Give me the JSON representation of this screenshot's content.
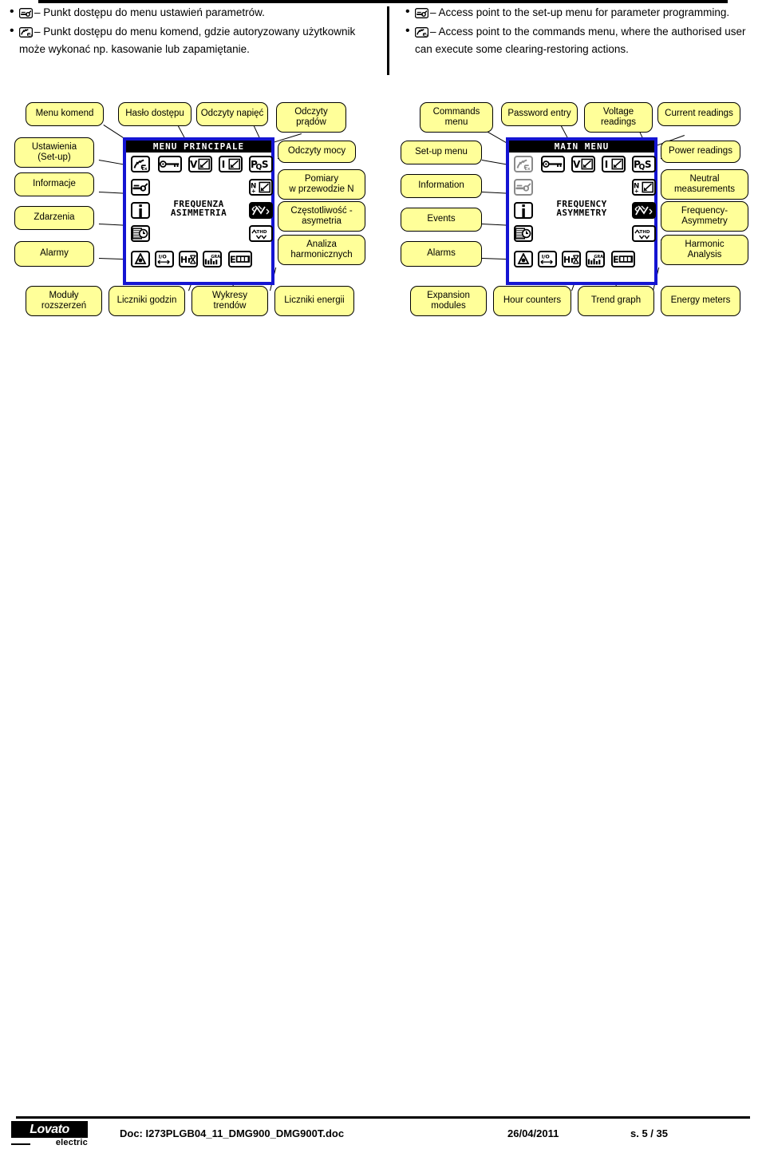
{
  "intro": {
    "left_bullets": [
      {
        "icon": "wrench-setup-icon",
        "text": "– Punkt dostępu do menu ustawień parametrów."
      },
      {
        "icon": "commands-hand-icon",
        "text": "– Punkt dostępu do menu komend, gdzie autoryzowany użytkownik może wykonać np. kasowanie lub zapamiętanie."
      }
    ],
    "right_bullets": [
      {
        "icon": "wrench-setup-icon",
        "text": "– Access point to the set-up menu for parameter programming."
      },
      {
        "icon": "commands-hand-icon",
        "text": "– Access point to the commands menu, where the authorised user can execute some clearing-restoring actions."
      }
    ]
  },
  "diagram_pl": {
    "lcd": {
      "title": "MENU PRINCIPALE",
      "center_line1": "FREQUENZA",
      "center_line2": "ASIMMETRIA",
      "border_color": "#1414d2"
    },
    "callouts": [
      {
        "name": "callout-commands-menu",
        "label": "Menu komend"
      },
      {
        "name": "callout-password-entry",
        "label": "Hasło dostępu"
      },
      {
        "name": "callout-voltage-readings",
        "label": "Odczyty napięć"
      },
      {
        "name": "callout-current-readings",
        "label": "Odczyty\nprądów"
      },
      {
        "name": "callout-setup-menu",
        "label": "Ustawienia\n(Set-up)"
      },
      {
        "name": "callout-power-readings",
        "label": "Odczyty mocy"
      },
      {
        "name": "callout-information",
        "label": "Informacje"
      },
      {
        "name": "callout-neutral",
        "label": "Pomiary\nw przewodzie N"
      },
      {
        "name": "callout-events",
        "label": "Zdarzenia"
      },
      {
        "name": "callout-frequency",
        "label": "Częstotliwość -\nasymetria"
      },
      {
        "name": "callout-alarms",
        "label": "Alarmy"
      },
      {
        "name": "callout-harmonic",
        "label": "Analiza\nharmonicznych"
      },
      {
        "name": "callout-expansion",
        "label": "Moduły\nrozszerzeń"
      },
      {
        "name": "callout-hour-counters",
        "label": "Liczniki godzin"
      },
      {
        "name": "callout-trend-graph",
        "label": "Wykresy\ntrendów"
      },
      {
        "name": "callout-energy-meters",
        "label": "Liczniki energii"
      }
    ]
  },
  "diagram_en": {
    "lcd": {
      "title": "MAIN MENU",
      "center_line1": "FREQUENCY",
      "center_line2": "ASYMMETRY",
      "border_color": "#1414d2"
    },
    "callouts": [
      {
        "name": "callout-commands-menu",
        "label": "Commands\nmenu"
      },
      {
        "name": "callout-password-entry",
        "label": "Password entry"
      },
      {
        "name": "callout-voltage-readings",
        "label": "Voltage\nreadings"
      },
      {
        "name": "callout-current-readings",
        "label": "Current readings"
      },
      {
        "name": "callout-setup-menu",
        "label": "Set-up menu"
      },
      {
        "name": "callout-power-readings",
        "label": "Power readings"
      },
      {
        "name": "callout-information",
        "label": "Information"
      },
      {
        "name": "callout-neutral",
        "label": "Neutral\nmeasurements"
      },
      {
        "name": "callout-events",
        "label": "Events"
      },
      {
        "name": "callout-frequency",
        "label": "Frequency-\nAsymmetry"
      },
      {
        "name": "callout-alarms",
        "label": "Alarms"
      },
      {
        "name": "callout-harmonic",
        "label": "Harmonic\nAnalysis"
      },
      {
        "name": "callout-expansion",
        "label": "Expansion\nmodules"
      },
      {
        "name": "callout-hour-counters",
        "label": "Hour counters"
      },
      {
        "name": "callout-trend-graph",
        "label": "Trend graph"
      },
      {
        "name": "callout-energy-meters",
        "label": "Energy meters"
      }
    ]
  },
  "lcd_icons": [
    {
      "name": "commands-hand-icon",
      "glyph": ""
    },
    {
      "name": "password-key-icon",
      "glyph": ""
    },
    {
      "name": "voltage-readings-icon",
      "glyph": "V"
    },
    {
      "name": "current-readings-icon",
      "glyph": "I"
    },
    {
      "name": "power-readings-icon",
      "glyph": "PQS"
    },
    {
      "name": "setup-wrench-icon",
      "glyph": ""
    },
    {
      "name": "neutral-measurement-icon",
      "glyph": "N"
    },
    {
      "name": "information-icon",
      "glyph": "i"
    },
    {
      "name": "frequency-asymmetry-icon",
      "glyph": ""
    },
    {
      "name": "events-clock-icon",
      "glyph": ""
    },
    {
      "name": "harmonic-thd-icon",
      "glyph": "THD"
    },
    {
      "name": "alarms-bell-icon",
      "glyph": ""
    },
    {
      "name": "expansion-io-icon",
      "glyph": "I/O"
    },
    {
      "name": "hour-counter-icon",
      "glyph": "Hr"
    },
    {
      "name": "trend-graph-icon",
      "glyph": "GRA"
    },
    {
      "name": "energy-meter-icon",
      "glyph": "E"
    }
  ],
  "footer": {
    "logo_main": "Lovato",
    "logo_sub": "electric",
    "doc": "Doc: I273PLGB04_11_DMG900_DMG900T.doc",
    "date": "26/04/2011",
    "page": "s. 5 / 35"
  }
}
